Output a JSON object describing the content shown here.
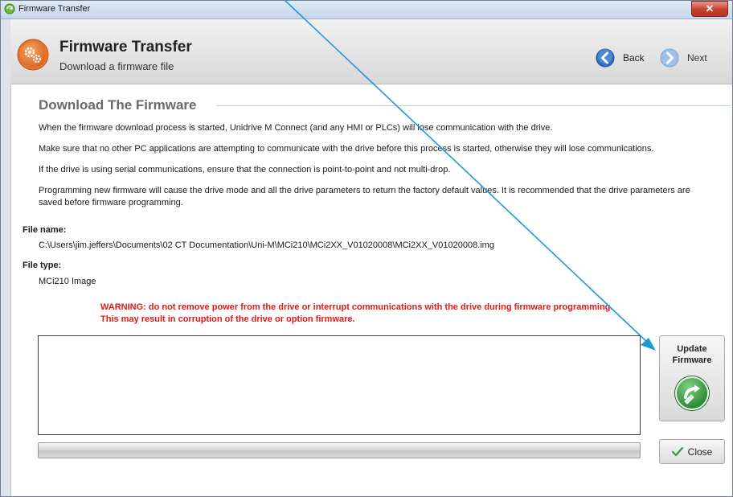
{
  "window": {
    "title": "Firmware Transfer",
    "close_glyph": "✕"
  },
  "header": {
    "title": "Firmware Transfer",
    "subtitle": "Download a firmware file",
    "back_label": "Back",
    "next_label": "Next",
    "icon": "gears-icon"
  },
  "content": {
    "section_title": "Download The Firmware",
    "paragraphs": [
      "When the firmware download process is started, Unidrive M Connect (and any HMI or PLCs) will lose communication with the drive.",
      "Make sure that no other PC applications are attempting to communicate with the drive before this process is started, otherwise they will lose communications.",
      "If the drive is using serial communications, ensure that the connection is point-to-point and not multi-drop.",
      "Programming new firmware will cause the drive mode and all the drive parameters to return the factory default values. It is recommended that the drive parameters are saved before firmware programming."
    ],
    "file_name_label": "File name:",
    "file_name_value": "C:\\Users\\jim.jeffers\\Documents\\02 CT Documentation\\Uni-M\\MCi210\\MCi2XX_V01020008\\MCi2XX_V01020008.img",
    "file_type_label": "File type:",
    "file_type_value": "MCi210 Image",
    "warning": "WARNING: do not remove power from the drive or interrupt communications with the drive during firmware programming. This may result in corruption of the drive or option firmware."
  },
  "actions": {
    "update_label_line1": "Update",
    "update_label_line2": "Firmware",
    "close_label": "Close"
  },
  "progress": {
    "value": 0
  },
  "colors": {
    "warning": "#e01818",
    "accent_arrow": "#1c9ad6",
    "header_icon": "#e8742e",
    "update_icon": "#2e9b3c"
  }
}
